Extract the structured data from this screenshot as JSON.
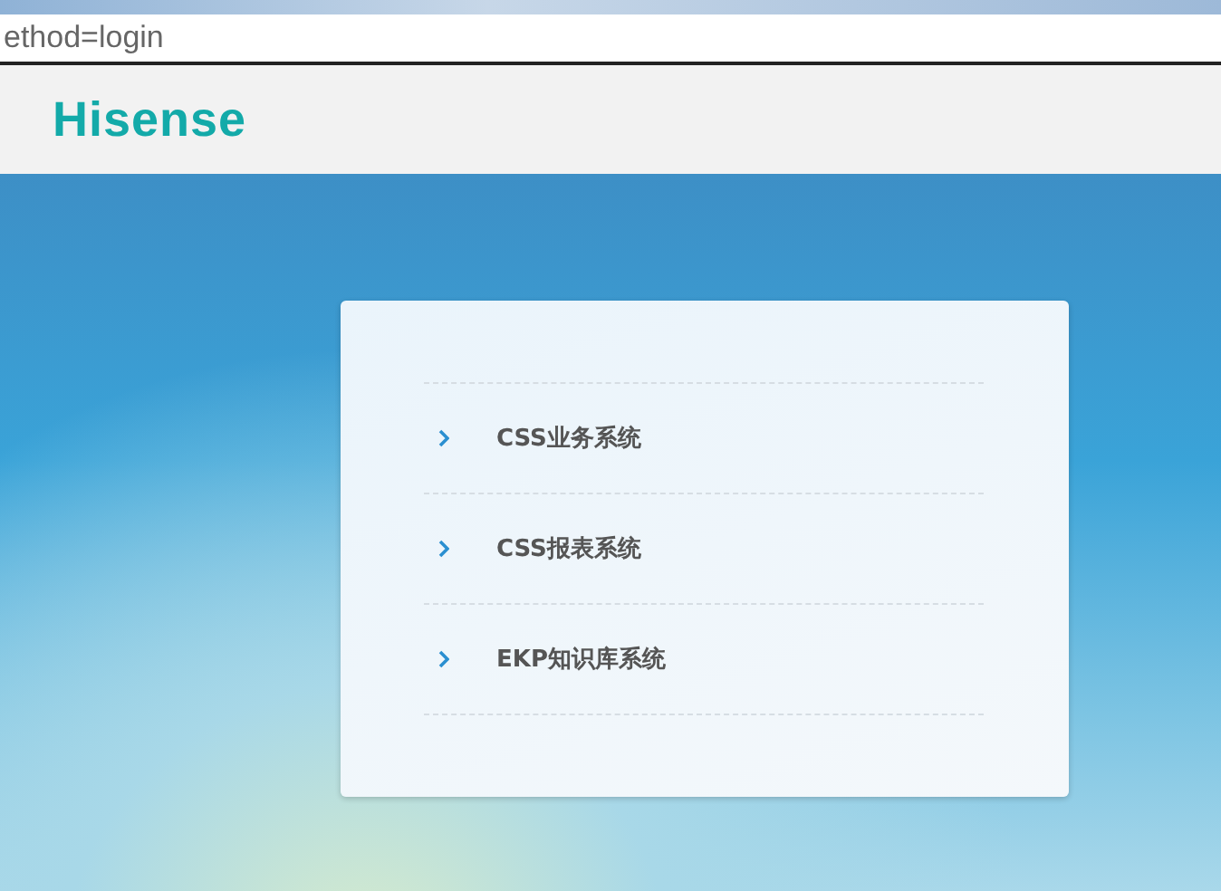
{
  "address_bar": {
    "url": "ethod=login"
  },
  "header": {
    "logo": "Hisense"
  },
  "systems": [
    {
      "label": "CSS业务系统"
    },
    {
      "label": "CSS报表系统"
    },
    {
      "label": "EKP知识库系统"
    }
  ]
}
